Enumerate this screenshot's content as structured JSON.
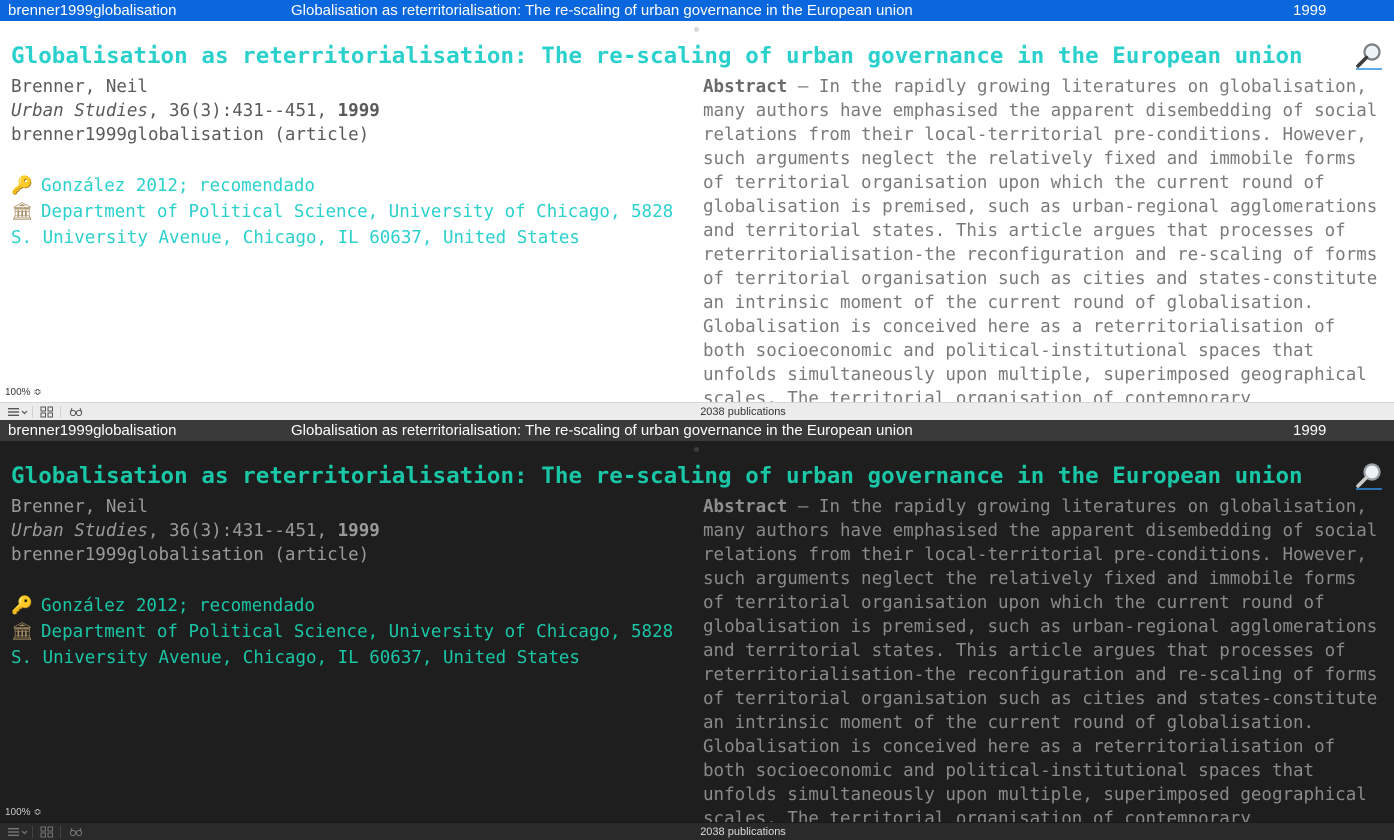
{
  "row": {
    "cite_key": "brenner1999globalisation",
    "title": "Globalisation as reterritorialisation: The re-scaling of urban governance in the European union",
    "year": "1999"
  },
  "detail": {
    "title": "Globalisation as reterritorialisation: The re-scaling of urban governance in the European union",
    "author": "Brenner, Neil",
    "journal": "Urban Studies",
    "volume_pages": ", 36(3):431--451, ",
    "year": "1999",
    "type_line": "brenner1999globalisation (article)",
    "keywords": "González 2012; recomendado",
    "affiliation": "Department of Political Science, University of Chicago, 5828 S. University Avenue, Chicago, IL 60637, United States",
    "abstract_label": "Abstract",
    "abstract_text": " — In the rapidly growing literatures on globalisation, many authors have emphasised the apparent disembedding of social relations from their local-territorial pre-conditions. However, such arguments neglect the relatively fixed and immobile forms of territorial organisation upon which the current round of globalisation is premised, such as urban-regional agglomerations and territorial states. This article argues that processes of reterritorialisation-the reconfiguration and re-scaling of forms of territorial organisation such as cities and states-constitute an intrinsic moment of the current round of globalisation. Globalisation is conceived here as a reterritorialisation of both socioeconomic and political-institutional spaces that unfolds simultaneously upon multiple, superimposed geographical scales. The territorial organisation of contemporary"
  },
  "zoom": "100% ≎",
  "status": {
    "count": "2038 publications"
  },
  "icons": {
    "magnifier": "magnifier-icon",
    "keywords": "key-icon",
    "affiliation": "institution-icon",
    "list_view": "list-view-icon",
    "grid_view": "grid-view-icon",
    "reader": "reading-glasses-icon"
  },
  "colors": {
    "selection_light": "#0a67de",
    "selection_dark": "#3a3a3a",
    "title_light": "#2ad0cc",
    "title_dark": "#19c6a6",
    "dark_background": "#1e1e1e"
  }
}
